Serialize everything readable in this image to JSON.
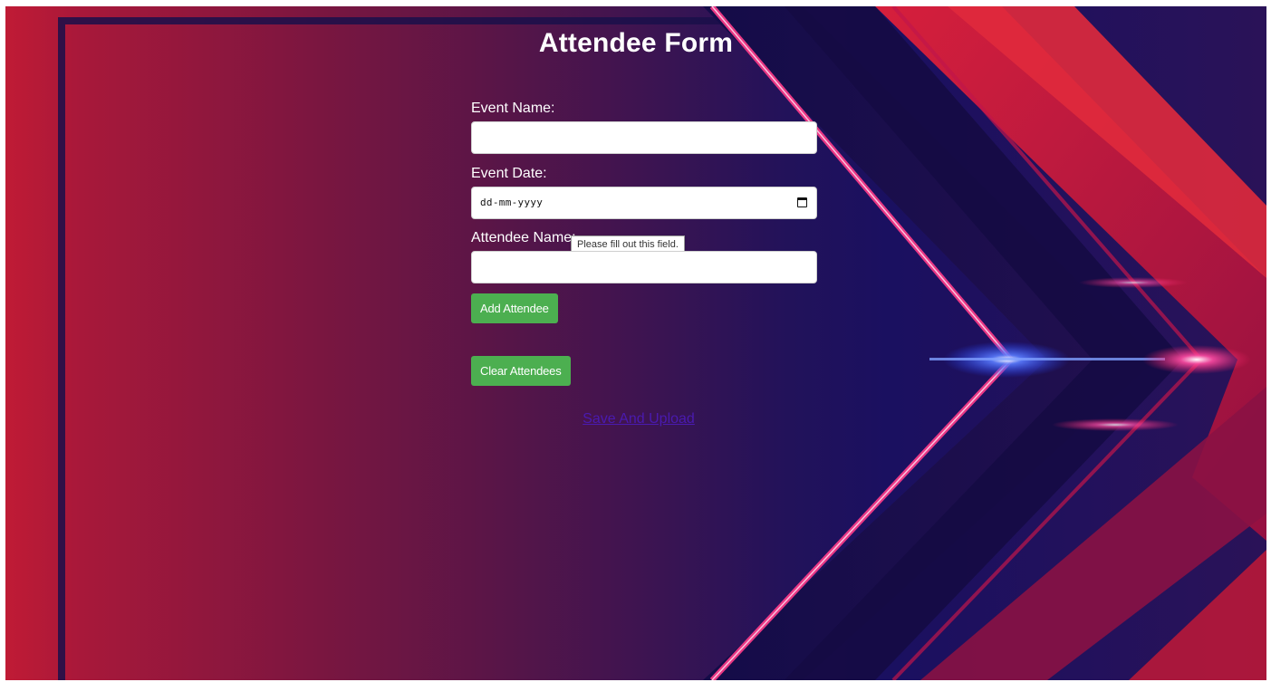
{
  "page": {
    "title": "Attendee Form"
  },
  "form": {
    "event_name_label": "Event Name:",
    "event_name_value": "",
    "event_date_label": "Event Date:",
    "event_date_placeholder": "dd-mm-yyyy",
    "attendee_name_label": "Attendee Name:",
    "attendee_name_value": "",
    "validation_tooltip": "Please fill out this field.",
    "add_button_label": "Add Attendee",
    "clear_button_label": "Clear Attendees",
    "save_link_label": "Save And Upload"
  },
  "colors": {
    "button": "#4caf50",
    "link": "#4a1ab0",
    "title": "#ffffff"
  },
  "icons": {
    "date_picker": "calendar-icon"
  }
}
